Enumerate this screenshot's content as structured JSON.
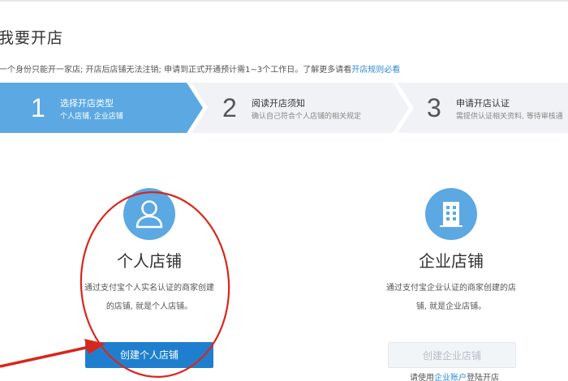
{
  "page": {
    "title": "我要开店",
    "notice_text": "一个身份只能开一家店; 开店后店铺无法注销; 申请到正式开通预计需1~3个工作日。了解更多请看",
    "notice_link": "开店规则必看"
  },
  "steps": [
    {
      "number": "1",
      "title": "选择开店类型",
      "subtitle": "个人店铺, 企业店铺",
      "active": true
    },
    {
      "number": "2",
      "title": "阅读开店须知",
      "subtitle": "确认自己符合个人店铺的相关规定",
      "active": false
    },
    {
      "number": "3",
      "title": "申请开店认证",
      "subtitle": "需提供认证相关资料, 等待审核通",
      "active": false
    }
  ],
  "cards": {
    "personal": {
      "icon": "user-icon",
      "title": "个人店铺",
      "desc_line1": "通过支付宝个人实名认证的商家创建",
      "desc_line2": "的店铺, 就是个人店铺。",
      "button": "创建个人店铺"
    },
    "enterprise": {
      "icon": "building-icon",
      "title": "企业店铺",
      "desc_line1": "通过支付宝企业认证的商家创建的店",
      "desc_line2": "铺, 就是企业店铺。",
      "button": "创建企业店铺",
      "hint_prefix": "请使用",
      "hint_link": "企业账户",
      "hint_suffix": "登陆开店"
    }
  },
  "colors": {
    "accent": "#1f7fce",
    "step_active": "#5ba8e3",
    "step_inactive": "#f0f2f5",
    "link": "#2f8bd8",
    "annotation": "#d9261c"
  }
}
